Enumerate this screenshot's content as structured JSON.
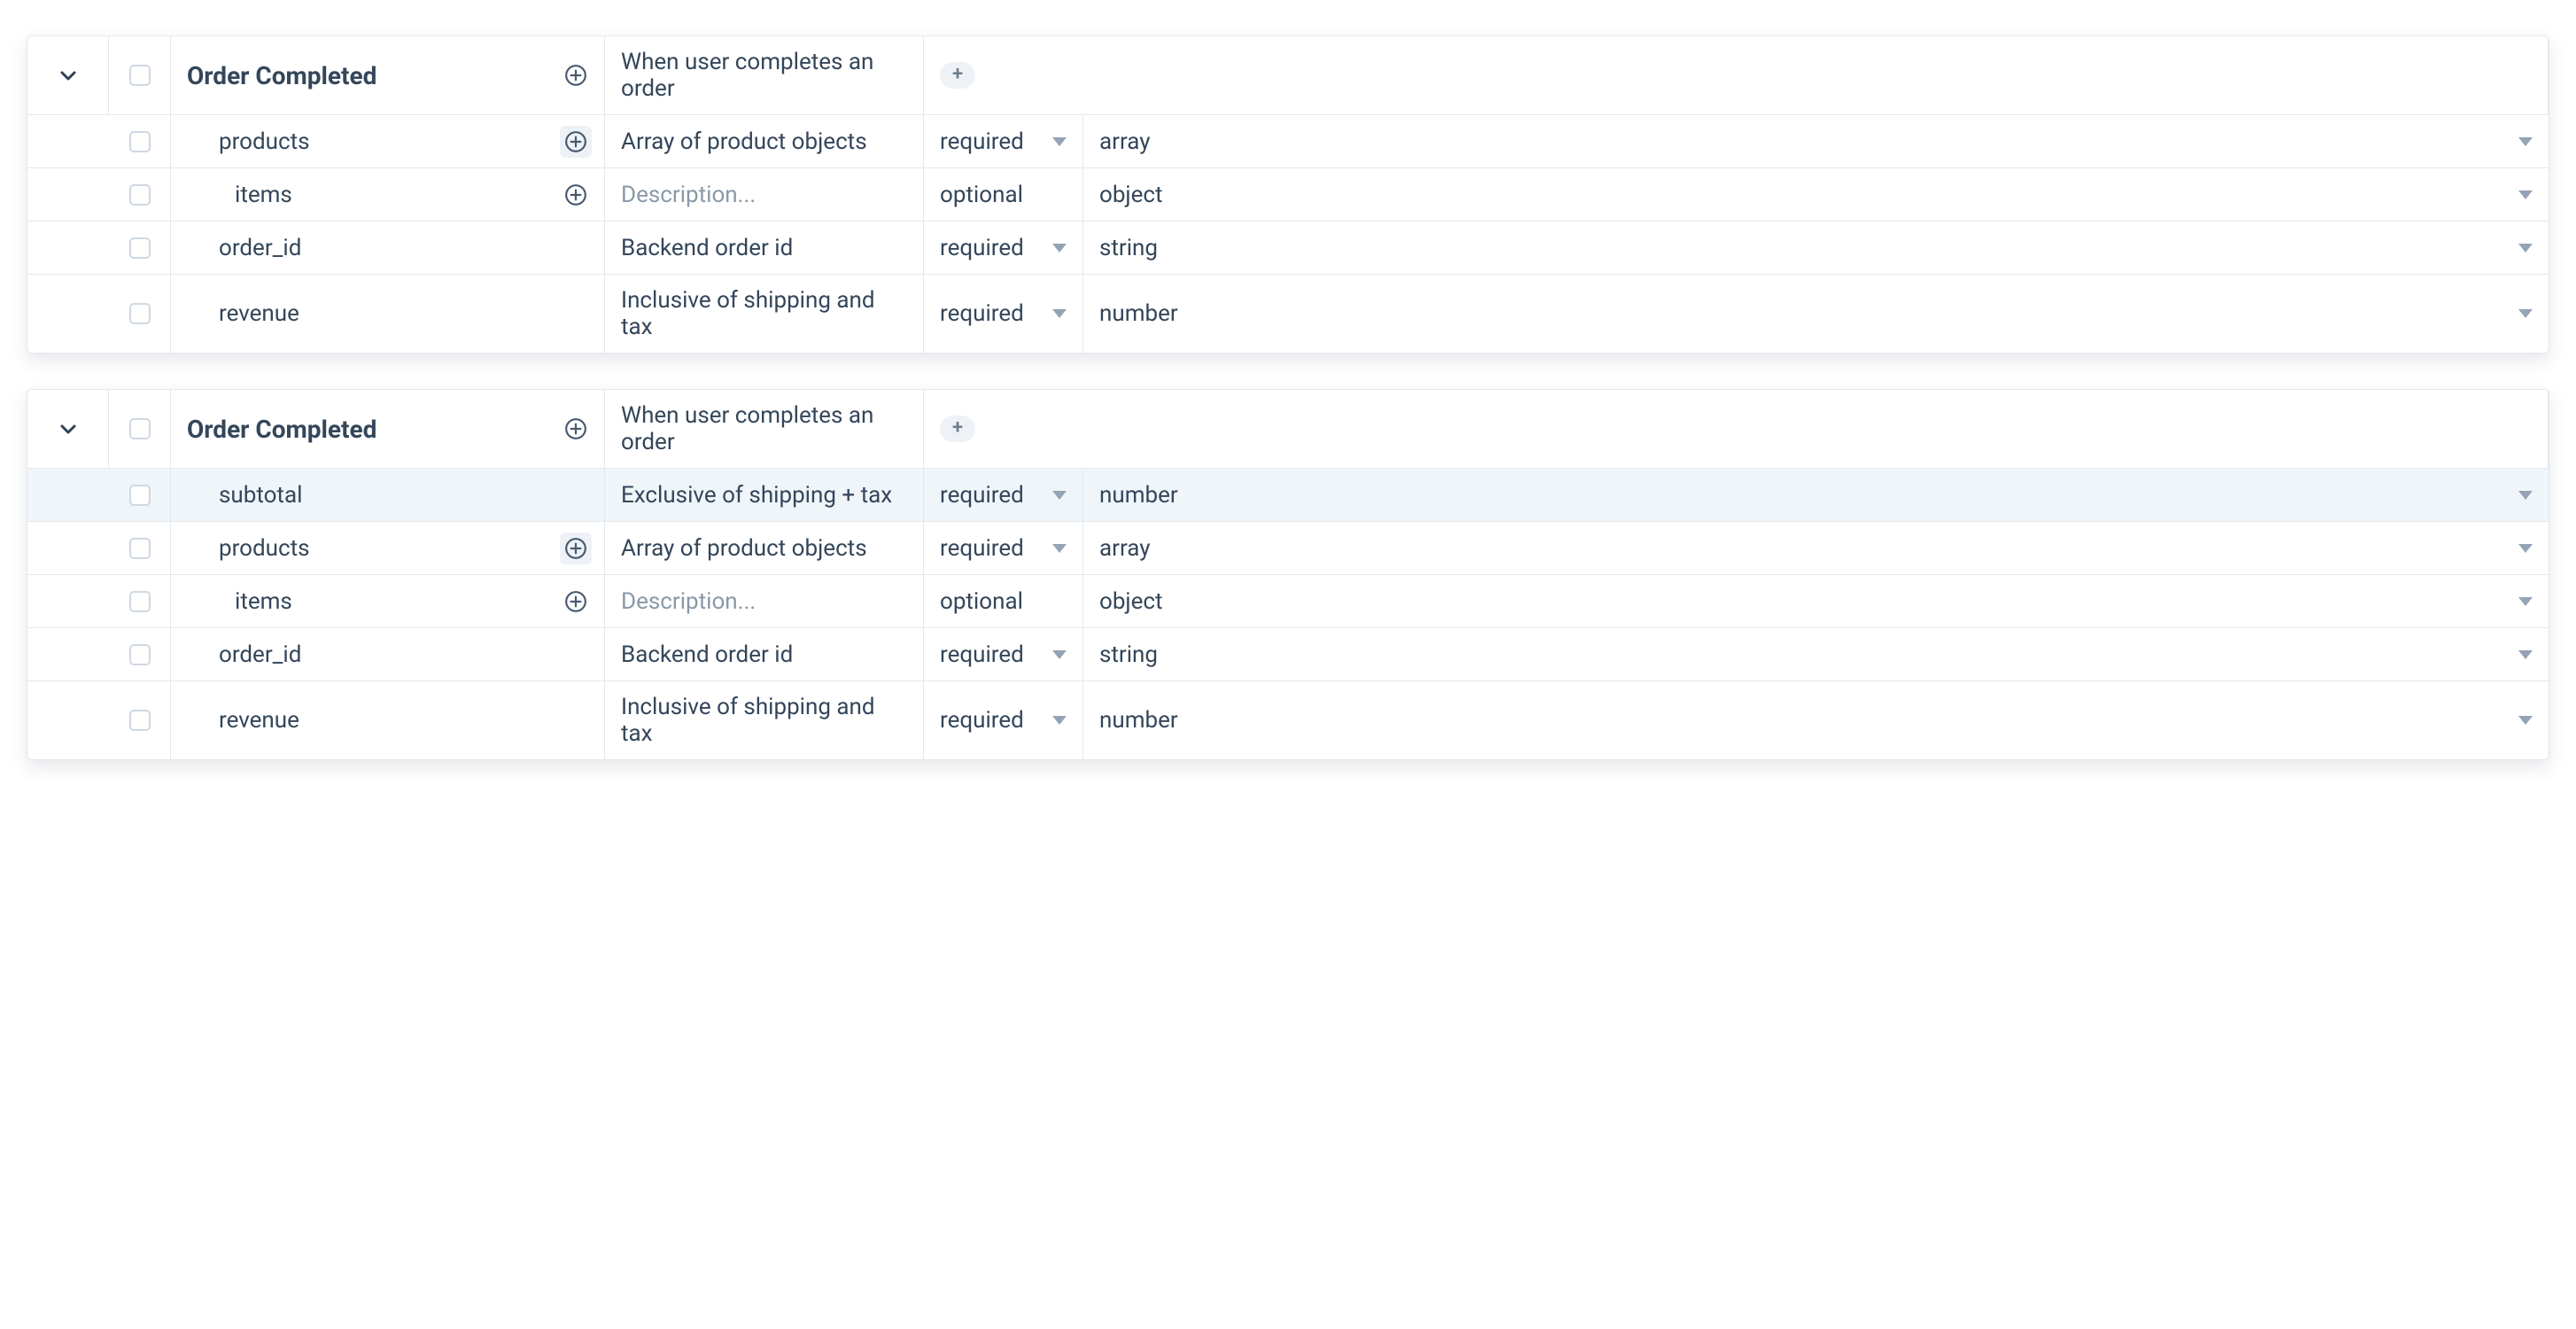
{
  "panels": [
    {
      "title": "Order Completed",
      "description": "When user completes an order",
      "rows": [
        {
          "name": "products",
          "desc": "Array of product objects",
          "req": "required",
          "type": "array",
          "indent": 1,
          "add": "boxed",
          "highlight": false
        },
        {
          "name": "items",
          "desc": "",
          "placeholder": "Description...",
          "req": "optional",
          "type": "object",
          "indent": 2,
          "add": "plain",
          "reqCaret": false,
          "highlight": false
        },
        {
          "name": "order_id",
          "desc": "Backend order id",
          "req": "required",
          "type": "string",
          "indent": 1,
          "highlight": false
        },
        {
          "name": "revenue",
          "desc": "Inclusive of shipping and tax",
          "req": "required",
          "type": "number",
          "indent": 1,
          "highlight": false
        }
      ]
    },
    {
      "title": "Order Completed",
      "description": "When user completes an order",
      "rows": [
        {
          "name": "subtotal",
          "desc": "Exclusive of shipping + tax",
          "req": "required",
          "type": "number",
          "indent": 1,
          "highlight": true
        },
        {
          "name": "products",
          "desc": "Array of product objects",
          "req": "required",
          "type": "array",
          "indent": 1,
          "add": "boxed",
          "highlight": false
        },
        {
          "name": "items",
          "desc": "",
          "placeholder": "Description...",
          "req": "optional",
          "type": "object",
          "indent": 2,
          "add": "plain",
          "reqCaret": false,
          "highlight": false
        },
        {
          "name": "order_id",
          "desc": "Backend order id",
          "req": "required",
          "type": "string",
          "indent": 1,
          "highlight": false
        },
        {
          "name": "revenue",
          "desc": "Inclusive of shipping and tax",
          "req": "required",
          "type": "number",
          "indent": 1,
          "highlight": false
        }
      ]
    }
  ]
}
